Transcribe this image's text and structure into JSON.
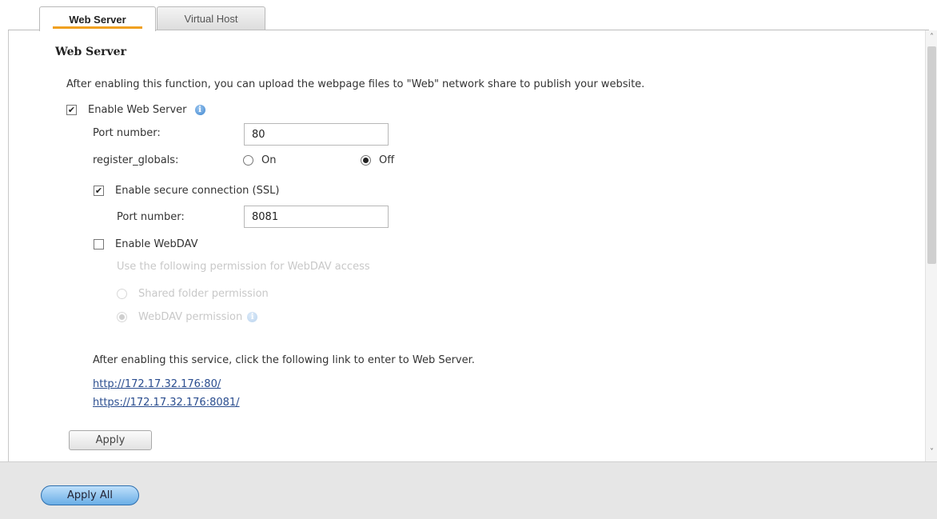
{
  "tabs": [
    {
      "label": "Web Server",
      "active": true
    },
    {
      "label": "Virtual Host",
      "active": false
    }
  ],
  "section": {
    "title": "Web Server",
    "description": "After enabling this function, you can upload the webpage files to \"Web\" network share to publish your website."
  },
  "web_server": {
    "enable_label": "Enable Web Server",
    "enabled": true,
    "port_label": "Port number:",
    "port_value": "80",
    "register_globals_label": "register_globals:",
    "option_on": "On",
    "option_off": "Off",
    "register_globals_value": "Off"
  },
  "ssl": {
    "enable_label": "Enable secure connection (SSL)",
    "enabled": true,
    "port_label": "Port number:",
    "port_value": "8081"
  },
  "webdav": {
    "enable_label": "Enable WebDAV",
    "enabled": false,
    "permission_label": "Use the following permission for WebDAV access",
    "option_shared": "Shared folder permission",
    "option_webdav": "WebDAV permission",
    "selected": "WebDAV permission"
  },
  "links": {
    "intro": "After enabling this service, click the following link to enter to Web Server.",
    "http": "http://172.17.32.176:80/",
    "https": "https://172.17.32.176:8081/"
  },
  "buttons": {
    "apply": "Apply",
    "apply_all": "Apply All"
  },
  "icons": {
    "info": "info-icon",
    "scroll_up": "chevron-up-icon",
    "scroll_down": "chevron-down-icon"
  },
  "colors": {
    "tab_accent": "#f0a020",
    "link": "#2a4d8f",
    "primary_button": "#6aaee6"
  }
}
